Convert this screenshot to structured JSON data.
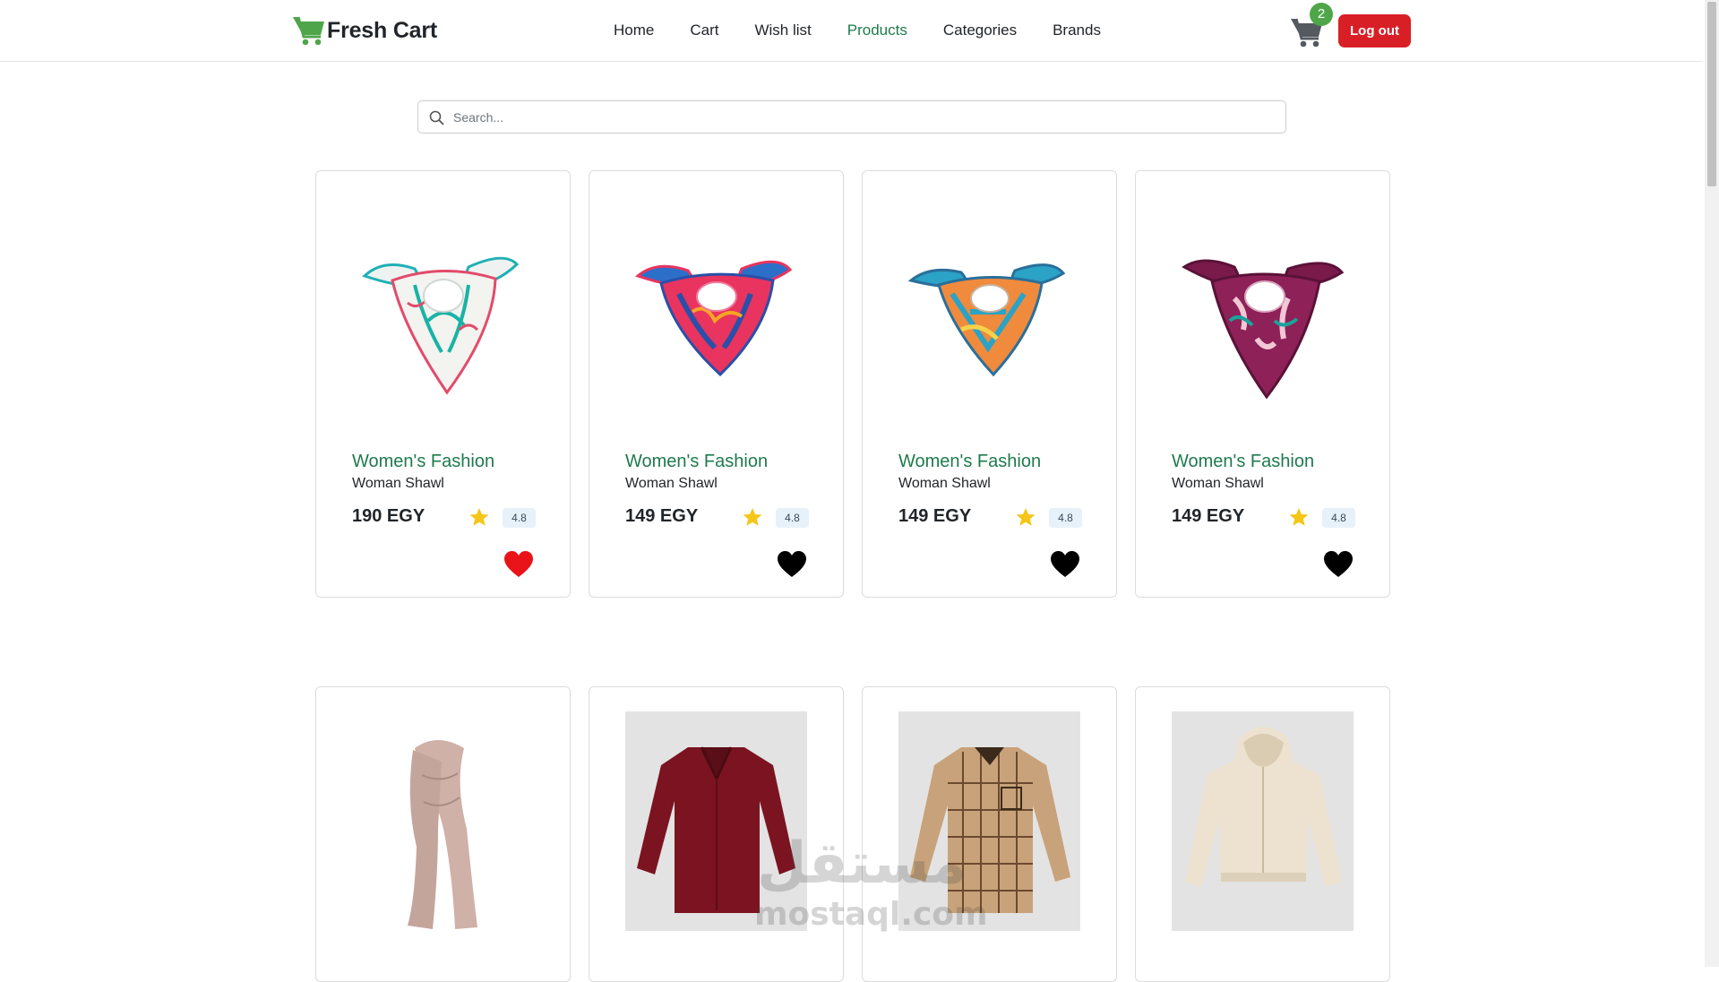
{
  "brand": {
    "name": "Fresh Cart",
    "icon": "cart-icon"
  },
  "nav": {
    "links": [
      "Home",
      "Cart",
      "Wish list",
      "Products",
      "Categories",
      "Brands"
    ],
    "active": "Products"
  },
  "cart": {
    "count": "2",
    "icon": "shopping-cart-icon"
  },
  "logout_label": "Log out",
  "search": {
    "placeholder": "Search...",
    "value": "",
    "icon": "search-icon"
  },
  "colors": {
    "brand_green": "#4fa64a",
    "category_green": "#1f7a4d",
    "danger": "#d91f26",
    "star": "#f5c518",
    "wish_active": "#e8141a"
  },
  "products": [
    {
      "category": "Women's Fashion",
      "title": "Woman Shawl",
      "price": "190 EGY",
      "rating": "4.8",
      "wishlisted": true,
      "image": "floral-white-scarf"
    },
    {
      "category": "Women's Fashion",
      "title": "Woman Shawl",
      "price": "149 EGY",
      "rating": "4.8",
      "wishlisted": false,
      "image": "pink-blue-scarf"
    },
    {
      "category": "Women's Fashion",
      "title": "Woman Shawl",
      "price": "149 EGY",
      "rating": "4.8",
      "wishlisted": false,
      "image": "teal-orange-scarf"
    },
    {
      "category": "Women's Fashion",
      "title": "Woman Shawl",
      "price": "149 EGY",
      "rating": "4.8",
      "wishlisted": false,
      "image": "plum-floral-scarf"
    },
    {
      "image": "beige-long-scarf"
    },
    {
      "image": "burgundy-blouse"
    },
    {
      "image": "plaid-shirt"
    },
    {
      "image": "cream-hoodie"
    }
  ],
  "watermark": {
    "arabic": "مستقل",
    "latin": "mostaql.com"
  }
}
